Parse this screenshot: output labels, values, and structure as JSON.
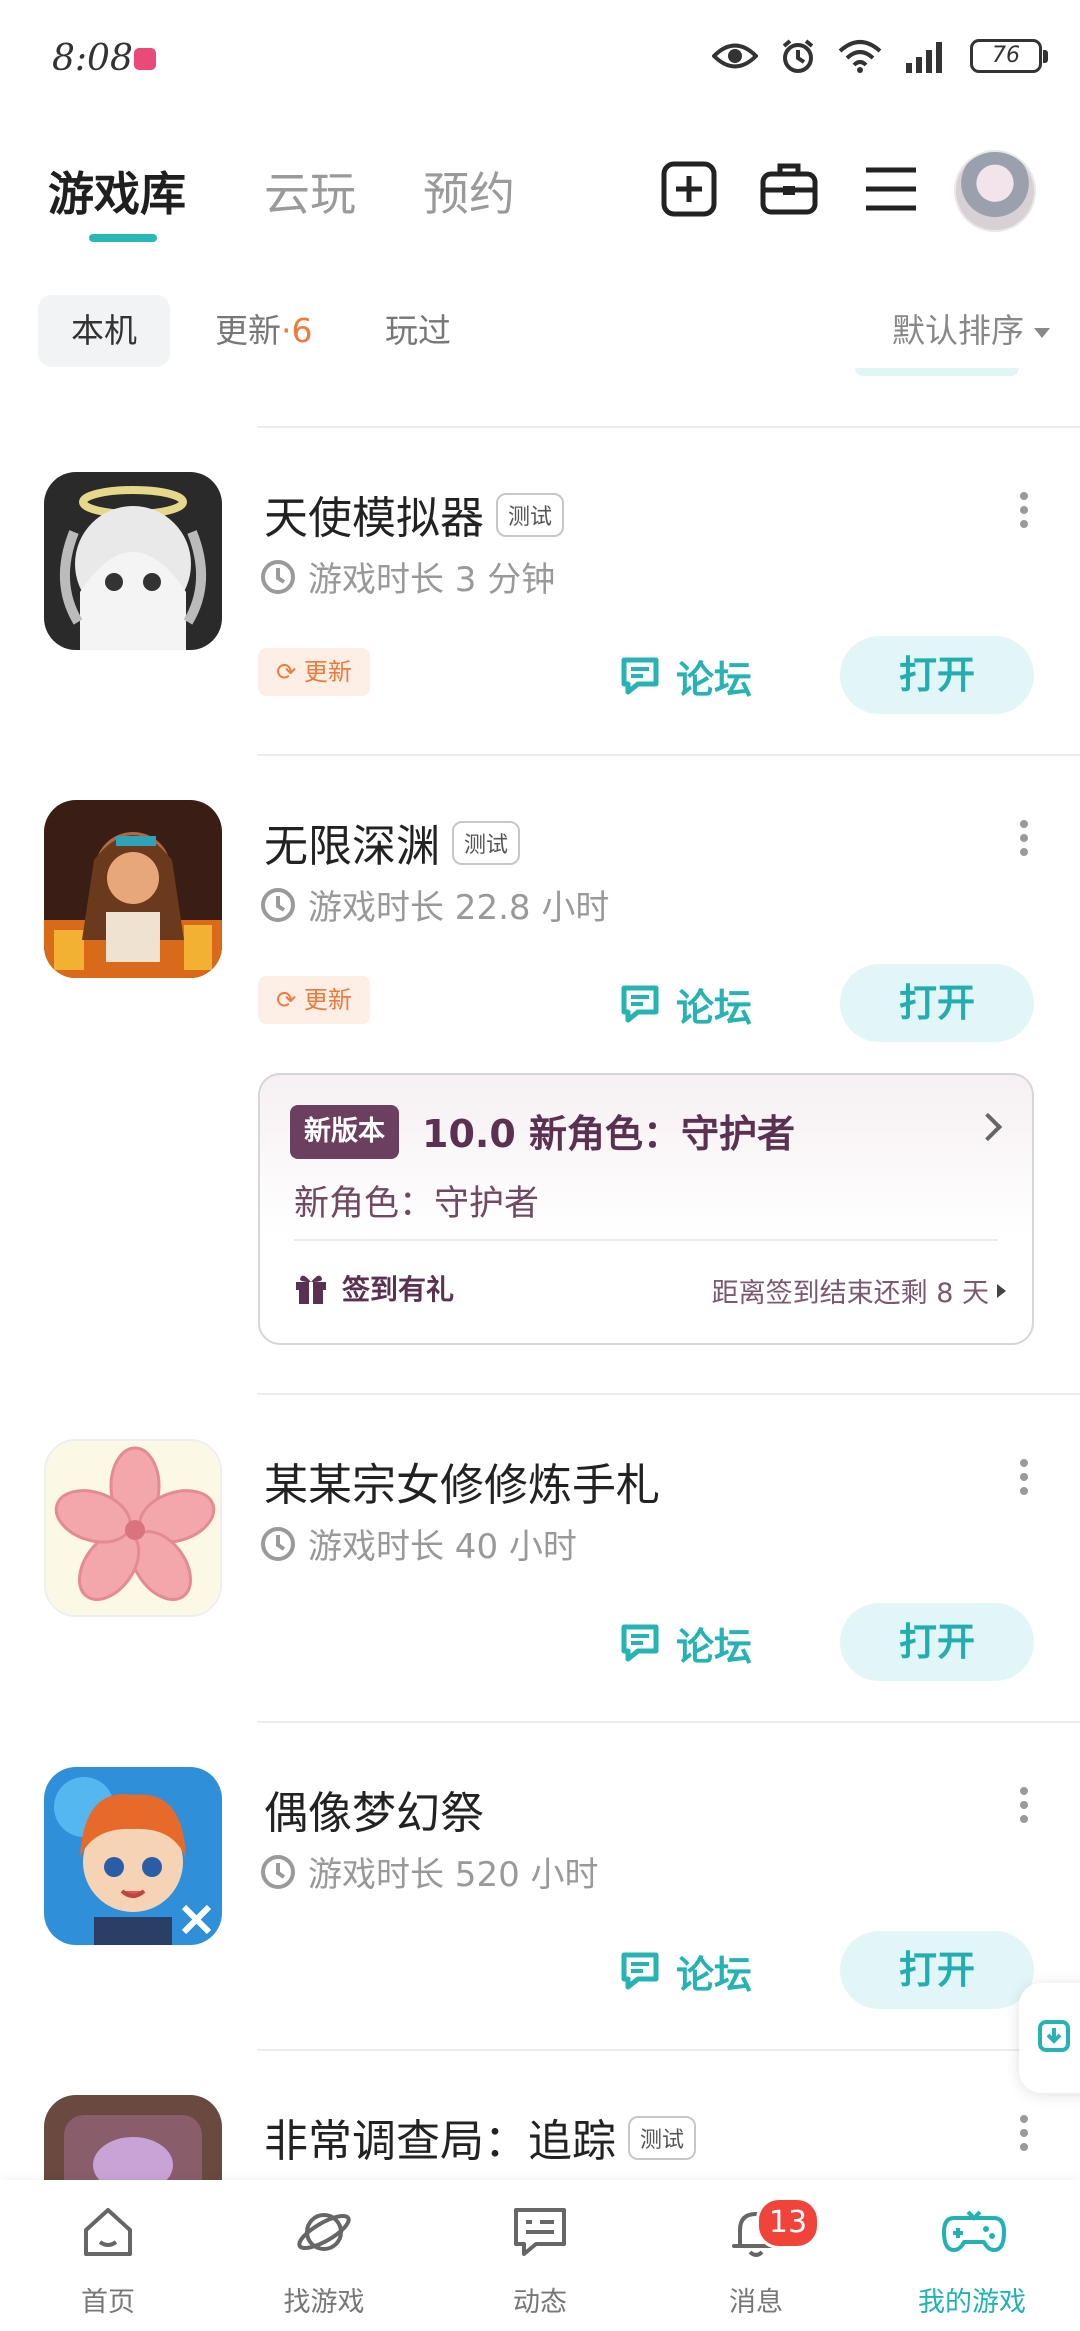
{
  "status_bar": {
    "time": "8:08",
    "battery": "76"
  },
  "header": {
    "tabs": [
      {
        "label": "游戏库",
        "active": true
      },
      {
        "label": "云玩",
        "active": false
      },
      {
        "label": "预约",
        "active": false
      }
    ],
    "icons": [
      "add-icon",
      "toolbox-icon",
      "menu-icon"
    ]
  },
  "filters": {
    "chips": [
      {
        "label": "本机",
        "active": true
      },
      {
        "label": "更新",
        "count": "·6"
      },
      {
        "label": "玩过"
      }
    ],
    "sort_label": "默认排序"
  },
  "games": [
    {
      "title": "天使模拟器",
      "tag": "测试",
      "playtime": "游戏时长 3 分钟",
      "update_badge": "更新",
      "forum": "论坛",
      "open": "打开"
    },
    {
      "title": "无限深渊",
      "tag": "测试",
      "playtime": "游戏时长 22.8 小时",
      "update_badge": "更新",
      "forum": "论坛",
      "open": "打开"
    },
    {
      "title": "某某宗女修修炼手札",
      "playtime": "游戏时长 40 小时",
      "forum": "论坛",
      "open": "打开"
    },
    {
      "title": "偶像梦幻祭",
      "playtime": "游戏时长 520 小时",
      "forum": "论坛",
      "open": "打开"
    },
    {
      "title": "非常调查局：追踪",
      "tag": "测试"
    }
  ],
  "promo": {
    "badge": "新版本",
    "headline": "10.0 新角色：守护者",
    "subtitle": "新角色：守护者",
    "gift_label": "签到有礼",
    "countdown": "距离签到结束还剩 8 天"
  },
  "bottom_nav": {
    "items": [
      {
        "label": "首页",
        "icon": "home-icon"
      },
      {
        "label": "找游戏",
        "icon": "planet-icon"
      },
      {
        "label": "动态",
        "icon": "chat-icon"
      },
      {
        "label": "消息",
        "icon": "bell-icon",
        "badge": "13"
      },
      {
        "label": "我的游戏",
        "icon": "gamepad-icon",
        "active": true
      }
    ]
  },
  "colors": {
    "accent": "#27b3b3",
    "update_orange": "#f07a3a",
    "promo_purple": "#6b3f5f",
    "badge_red": "#f0443a"
  }
}
